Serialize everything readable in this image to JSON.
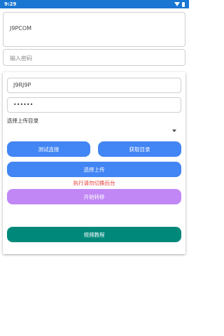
{
  "status_bar": {
    "time": "9:29"
  },
  "form": {
    "top_field_value": "J9PCOM",
    "password_placeholder": "输入密码"
  },
  "panel": {
    "username_value": "J9RJ9P",
    "password_value": "••••••",
    "dir_label": "选择上传目录",
    "btn_test": "测试连接",
    "btn_getdir": "获取目录",
    "btn_upload": "选择上传",
    "warning": "执行请勿切换后台",
    "btn_start": "开始转移",
    "btn_video": "视频教程"
  },
  "colors": {
    "status_bar": "#1976d2",
    "primary_button": "#4285f4",
    "start_button": "#c187f5",
    "video_button": "#00897b",
    "warning_text": "#e53935"
  }
}
